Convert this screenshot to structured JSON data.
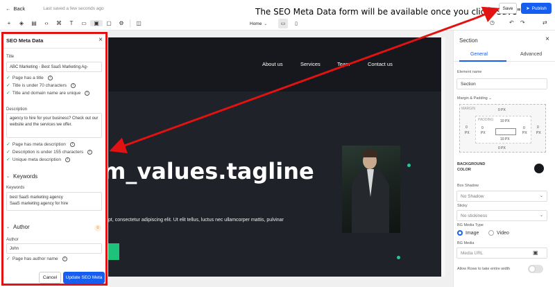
{
  "topbar": {
    "back_label": "Back",
    "saved_text": "Last saved a few seconds ago",
    "annotation": "The SEO Meta Data form will be available once you click \"Save\"",
    "save_label": "Save",
    "publish_label": "Publish"
  },
  "toolbar": {
    "page_select": "Home"
  },
  "seo_panel": {
    "title": "SEO Meta Data",
    "title_label": "Title",
    "title_value": "ABC Marketing - Best SaaS Marketing Ag-",
    "title_checks": [
      "Page has a title",
      "Title is under 70 characters",
      "Title and domain name are unique"
    ],
    "description_label": "Description",
    "description_value": "agency to hire for your business? Check out our website and the services we offer.",
    "description_checks": [
      "Page has meta description",
      "Description is under 155 characters",
      "Unique meta description"
    ],
    "keywords_section": "Keywords",
    "keywords_label": "Keywords",
    "keywords_lines": [
      "best SaaS marketing agency",
      "SaaS marketing agency for hire"
    ],
    "author_section": "Author",
    "author_badge": "0",
    "author_label": "Author",
    "author_value": "John",
    "author_checks": [
      "Page has author name"
    ],
    "cancel_label": "Cancel",
    "update_label": "Update SEO Meta"
  },
  "site": {
    "nav": [
      "About us",
      "Services",
      "Team",
      "Contact us"
    ],
    "tagline": "m_values.tagline",
    "lorem": "pt, consectetur adipiscing elit. Ut elit tellus, luctus nec ullamcorper mattis, pulvinar"
  },
  "props": {
    "title": "Section",
    "tabs": [
      "General",
      "Advanced"
    ],
    "element_name_label": "Element name",
    "element_name_value": "Section",
    "margin_padding_label": "Margin & Padding",
    "margin_label": "MARGIN",
    "padding_label": "PADDING",
    "values": {
      "margin_top": "0 PX",
      "margin_bottom": "0 PX",
      "margin_left": "0",
      "margin_left_unit": "PX",
      "margin_right": "0",
      "margin_right_unit": "PX",
      "padding_top": "10 PX",
      "padding_bottom": "10 PX",
      "padding_left": "0",
      "padding_left_unit": "PX",
      "padding_right": "0",
      "padding_right_unit": "PX"
    },
    "bg_color_label_1": "BACKGROUND",
    "bg_color_label_2": "COLOR",
    "bg_color": "#16181d",
    "box_shadow_label": "Box Shadow",
    "box_shadow_value": "No Shadow",
    "sticky_label": "Sticky",
    "sticky_value": "No stickiness",
    "bg_media_type_label": "BG Media Type",
    "media_options": [
      "Image",
      "Video"
    ],
    "media_selected": "Image",
    "bg_media_label": "BG Media",
    "media_url_placeholder": "Media URL",
    "allow_rows_label": "Allow Rows to take entire width"
  },
  "colors": {
    "accent": "#155eef",
    "annotation_red": "#e31212",
    "site_dark": "#16181d",
    "success": "#1a9d56"
  }
}
